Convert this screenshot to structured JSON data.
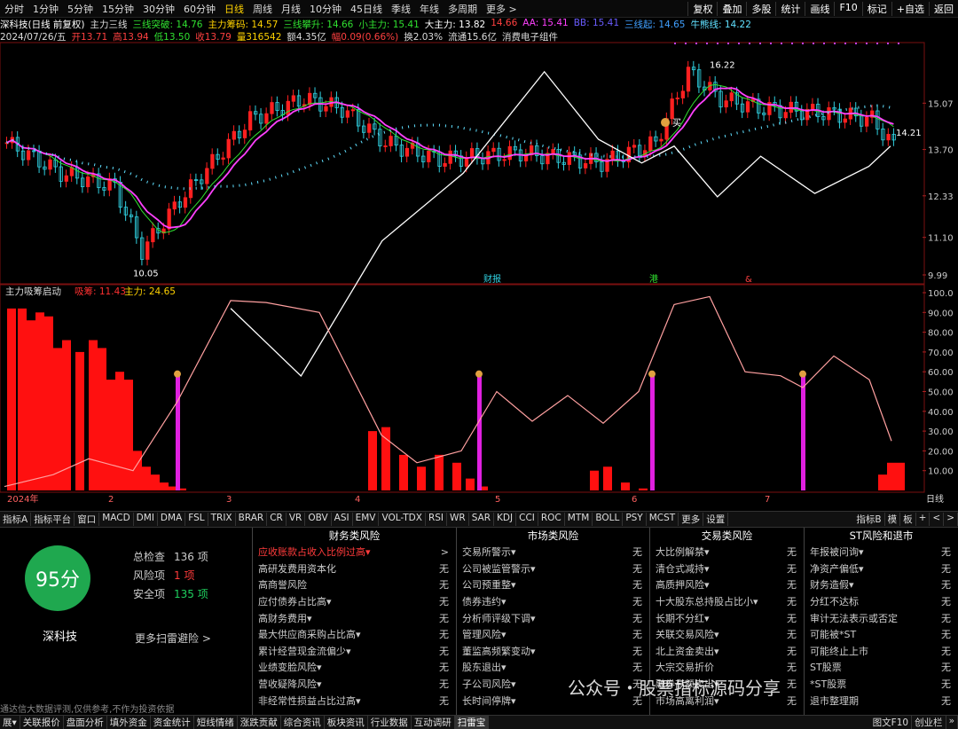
{
  "period_bar": {
    "items": [
      "分时",
      "1分钟",
      "5分钟",
      "15分钟",
      "30分钟",
      "60分钟",
      "日线",
      "周线",
      "月线",
      "10分钟",
      "45日线",
      "季线",
      "年线",
      "多周期",
      "更多 >"
    ],
    "active": "日线",
    "right": [
      "复权",
      "叠加",
      "多股",
      "统计",
      "画线",
      "F10",
      "标记",
      "+自选",
      "返回"
    ]
  },
  "info1": {
    "name": "深科技(日线 前复权)",
    "items": [
      {
        "t": "主力三线",
        "c": "#dddddd"
      },
      {
        "t": "三线突破: 14.76",
        "c": "#30e030"
      },
      {
        "t": "主力筹码: 14.57",
        "c": "#ffd200"
      },
      {
        "t": "三线攀升: 14.66",
        "c": "#30e030"
      },
      {
        "t": "小主力: 15.41",
        "c": "#30e030"
      },
      {
        "t": "大主力: 13.82",
        "c": "#ffffff"
      },
      {
        "t": "14.66",
        "c": "#ff4040"
      },
      {
        "t": "AA: 15.41",
        "c": "#ff40ff"
      },
      {
        "t": "BB: 15.41",
        "c": "#6a5cff"
      },
      {
        "t": "三线起: 14.65",
        "c": "#40a0ff"
      },
      {
        "t": "牛熊线: 14.22",
        "c": "#60e0ff"
      }
    ]
  },
  "info2": {
    "items": [
      {
        "t": "2024/07/26/五",
        "c": "#dddddd"
      },
      {
        "t": "开13.71",
        "c": "#ff4040"
      },
      {
        "t": "高13.94",
        "c": "#ff4040"
      },
      {
        "t": "低13.50",
        "c": "#30e030"
      },
      {
        "t": "收13.79",
        "c": "#ff4040"
      },
      {
        "t": "量316542",
        "c": "#ffd200"
      },
      {
        "t": "额4.35亿",
        "c": "#dddddd"
      },
      {
        "t": "幅0.09(0.66%)",
        "c": "#ff4040"
      },
      {
        "t": "换2.03%",
        "c": "#dddddd"
      },
      {
        "t": "流通15.6亿",
        "c": "#dddddd"
      },
      {
        "t": "消费电子组件",
        "c": "#dddddd"
      }
    ]
  },
  "main_chart": {
    "y_ticks": [
      "15.07",
      "13.70",
      "12.33",
      "11.10",
      "9.99"
    ],
    "high_label": "16.22",
    "low_label": "10.05",
    "last_label": "14.21",
    "buy_label": "买",
    "markers": [
      "财报",
      "港",
      "&"
    ]
  },
  "sub_chart": {
    "title": "主力吸筹启动",
    "legend": [
      {
        "t": "吸筹: 11.43",
        "c": "#ff3030"
      },
      {
        "t": "主力: 24.65",
        "c": "#ffd200"
      }
    ],
    "y_ticks": [
      "100.0",
      "90.00",
      "80.00",
      "70.00",
      "60.00",
      "50.00",
      "40.00",
      "30.00",
      "20.00",
      "10.00"
    ]
  },
  "x_axis": {
    "labels": [
      "2024年",
      "2",
      "3",
      "4",
      "5",
      "6",
      "7"
    ],
    "right_label": "日线"
  },
  "indicator_tabs": {
    "items": [
      "指标A",
      "指标平台",
      "窗口",
      "MACD",
      "DMI",
      "DMA",
      "FSL",
      "TRIX",
      "BRAR",
      "CR",
      "VR",
      "OBV",
      "ASI",
      "EMV",
      "VOL-TDX",
      "RSI",
      "WR",
      "SAR",
      "KDJ",
      "CCI",
      "ROC",
      "MTM",
      "BOLL",
      "PSY",
      "MCST",
      "更多",
      "设置"
    ],
    "right": [
      "指标B",
      "模",
      "板",
      "+",
      "<",
      ">"
    ]
  },
  "risk_scan": {
    "score": "95分",
    "stock_name": "深科技",
    "total_label": "总检查",
    "total": "136 项",
    "risk_label": "风险项",
    "risk": "1 项",
    "safe_label": "安全项",
    "safe": "135 项",
    "more": "更多扫雷避险 >",
    "note": "通达信大数据评测,仅供参考,不作为投资依据",
    "categories": [
      {
        "title": "财务类风险",
        "items": [
          {
            "n": "应收账款占收入比例过高▾",
            "v": ">",
            "hl": true
          },
          {
            "n": "高研发费用资本化",
            "v": "无"
          },
          {
            "n": "高商誉风险",
            "v": "无"
          },
          {
            "n": "应付债券占比高▾",
            "v": "无"
          },
          {
            "n": "高财务费用▾",
            "v": "无"
          },
          {
            "n": "最大供应商采购占比高▾",
            "v": "无"
          },
          {
            "n": "累计经营现金流偏少▾",
            "v": "无"
          },
          {
            "n": "业绩变脸风险▾",
            "v": "无"
          },
          {
            "n": "营收疑降风险▾",
            "v": "无"
          },
          {
            "n": "非经常性损益占比过高▾",
            "v": "无"
          }
        ]
      },
      {
        "title": "市场类风险",
        "items": [
          {
            "n": "交易所警示▾",
            "v": "无"
          },
          {
            "n": "公司被监管警示▾",
            "v": "无"
          },
          {
            "n": "公司预重整▾",
            "v": "无"
          },
          {
            "n": "债券违约▾",
            "v": "无"
          },
          {
            "n": "分析师评级下调▾",
            "v": "无"
          },
          {
            "n": "管理风险▾",
            "v": "无"
          },
          {
            "n": "董监高频繁变动▾",
            "v": "无"
          },
          {
            "n": "股东退出▾",
            "v": "无"
          },
          {
            "n": "子公司风险▾",
            "v": "无"
          },
          {
            "n": "长时间停牌▾",
            "v": "无"
          }
        ]
      },
      {
        "title": "交易类风险",
        "items": [
          {
            "n": "大比例解禁▾",
            "v": "无"
          },
          {
            "n": "清仓式减持▾",
            "v": "无"
          },
          {
            "n": "高质押风险▾",
            "v": "无"
          },
          {
            "n": "十大股东总持股占比小▾",
            "v": "无"
          },
          {
            "n": "长期不分红▾",
            "v": "无"
          },
          {
            "n": "关联交易风险▾",
            "v": "无"
          },
          {
            "n": "北上资金卖出▾",
            "v": "无"
          },
          {
            "n": "大宗交易折价",
            "v": "无"
          },
          {
            "n": "融券高额卖出▾",
            "v": "无"
          },
          {
            "n": "市场高离利润▾",
            "v": "无"
          }
        ]
      },
      {
        "title": "ST风险和退市",
        "items": [
          {
            "n": "年报被问询▾",
            "v": "无"
          },
          {
            "n": "净资产偏低▾",
            "v": "无"
          },
          {
            "n": "财务造假▾",
            "v": "无"
          },
          {
            "n": "分红不达标",
            "v": "无"
          },
          {
            "n": "审计无法表示或否定",
            "v": "无"
          },
          {
            "n": "可能被*ST",
            "v": "无"
          },
          {
            "n": "可能终止上市",
            "v": "无"
          },
          {
            "n": "ST股票",
            "v": "无"
          },
          {
            "n": "*ST股票",
            "v": "无"
          },
          {
            "n": "退市整理期",
            "v": "无"
          }
        ]
      }
    ]
  },
  "watermark": "公众号・股票指标源码分享",
  "bottom_bar": {
    "items": [
      "展▾",
      "关联报价",
      "盘面分析",
      "填外资金",
      "资金统计",
      "短线情绪",
      "涨跌贡献",
      "综合资讯",
      "板块资讯",
      "行业数据",
      "互动调研",
      "扫雷宝"
    ],
    "active": "扫雷宝",
    "right": [
      "图文F10",
      "创业栏",
      "»"
    ]
  }
}
